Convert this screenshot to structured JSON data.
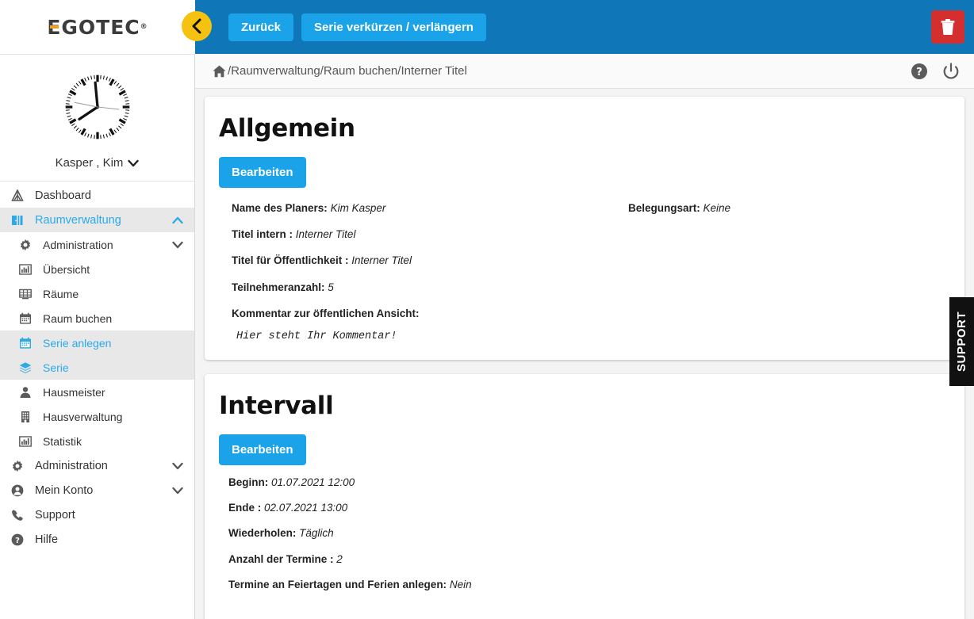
{
  "brand": {
    "name": "EGOTEC",
    "registered": "®",
    "accent_color": "#f0a020",
    "text_color": "#3c3c3c"
  },
  "topbar": {
    "background_color": "#0f77b8",
    "button_color": "#1aa3e8",
    "collapse_icon": "chevron-left-icon",
    "collapse_bg": "#f5c211",
    "buttons": [
      {
        "label": "Zurück"
      },
      {
        "label": "Serie verkürzen / verlängern"
      }
    ],
    "delete": {
      "icon": "trash-icon",
      "color": "#d32f2f"
    }
  },
  "breadcrumb": {
    "home_icon": "home-icon",
    "path": "/Raumverwaltung/Raum buchen/Interner Titel",
    "icons": [
      {
        "name": "help-icon"
      },
      {
        "name": "power-icon"
      }
    ]
  },
  "sidebar": {
    "user": {
      "name": "Kasper , Kim",
      "avatar": "clock-icon",
      "chevron": "chevron-down-icon"
    },
    "items": [
      {
        "label": "Dashboard",
        "icon": "tent-icon",
        "level": 0,
        "state": "normal",
        "chevron": ""
      },
      {
        "label": "Raumverwaltung",
        "icon": "door-icon",
        "level": 0,
        "state": "active",
        "chevron": "chevron-up-icon"
      },
      {
        "label": "Administration",
        "icon": "gear-icon",
        "level": 1,
        "state": "normal",
        "chevron": "chevron-down-icon"
      },
      {
        "label": "Übersicht",
        "icon": "chart-icon",
        "level": 1,
        "state": "normal",
        "chevron": ""
      },
      {
        "label": "Räume",
        "icon": "grid-icon",
        "level": 1,
        "state": "normal",
        "chevron": ""
      },
      {
        "label": "Raum buchen",
        "icon": "calendar-icon",
        "level": 1,
        "state": "normal",
        "chevron": ""
      },
      {
        "label": "Serie anlegen",
        "icon": "calendar-icon",
        "level": 1,
        "state": "highlight",
        "chevron": ""
      },
      {
        "label": "Serie",
        "icon": "layers-icon",
        "level": 1,
        "state": "highlight",
        "chevron": ""
      },
      {
        "label": "Hausmeister",
        "icon": "person-icon",
        "level": 1,
        "state": "normal",
        "chevron": ""
      },
      {
        "label": "Hausverwaltung",
        "icon": "building-icon",
        "level": 1,
        "state": "normal",
        "chevron": ""
      },
      {
        "label": "Statistik",
        "icon": "chart-icon",
        "level": 1,
        "state": "normal",
        "chevron": ""
      },
      {
        "label": "Administration",
        "icon": "gear-icon",
        "level": 0,
        "state": "normal",
        "chevron": "chevron-down-icon"
      },
      {
        "label": "Mein Konto",
        "icon": "user-circle-icon",
        "level": 0,
        "state": "normal",
        "chevron": "chevron-down-icon"
      },
      {
        "label": "Support",
        "icon": "phone-icon",
        "level": 0,
        "state": "normal",
        "chevron": ""
      },
      {
        "label": "Hilfe",
        "icon": "help-icon",
        "level": 0,
        "state": "normal",
        "chevron": ""
      }
    ]
  },
  "main": {
    "cards": [
      {
        "title": "Allgemein",
        "edit_label": "Bearbeiten",
        "left_fields": [
          {
            "label": "Name des Planers:",
            "value": "Kim Kasper"
          },
          {
            "label": "Titel intern :",
            "value": "Interner Titel"
          },
          {
            "label": "Titel für Öffentlichkeit :",
            "value": "Interner Titel"
          },
          {
            "label": "Teilnehmeranzahl:",
            "value": "5"
          },
          {
            "label": "Kommentar zur öffentlichen Ansicht:",
            "value": ""
          }
        ],
        "comment": "Hier steht Ihr Kommentar!",
        "right_fields": [
          {
            "label": "Belegungsart:",
            "value": "Keine"
          }
        ]
      },
      {
        "title": "Intervall",
        "edit_label": "Bearbeiten",
        "left_fields": [
          {
            "label": "Beginn:",
            "value": "01.07.2021 12:00"
          },
          {
            "label": "Ende :",
            "value": "02.07.2021 13:00"
          },
          {
            "label": "Wiederholen:",
            "value": "Täglich"
          },
          {
            "label": "Anzahl der Termine :",
            "value": "2"
          },
          {
            "label": "Termine an Feiertagen und Ferien anlegen:",
            "value": "Nein"
          }
        ],
        "comment": "",
        "right_fields": []
      }
    ]
  },
  "support_tab": {
    "label": "SUPPORT",
    "background": "#111111"
  }
}
